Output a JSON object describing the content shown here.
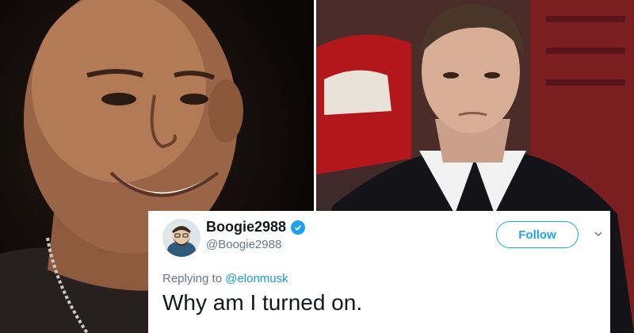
{
  "tweet": {
    "display_name": "Boogie2988",
    "handle": "@Boogie2988",
    "verified": true,
    "follow_label": "Follow",
    "replying_prefix": "Replying to",
    "replying_to": "@elonmusk",
    "text": "Why am I turned on."
  },
  "icons": {
    "verified": "verified-badge-icon",
    "chevron": "chevron-down-icon"
  },
  "colors": {
    "accent": "#1da1f2",
    "mention": "#1b95e0",
    "text_primary": "#14171a",
    "text_secondary": "#657786"
  }
}
